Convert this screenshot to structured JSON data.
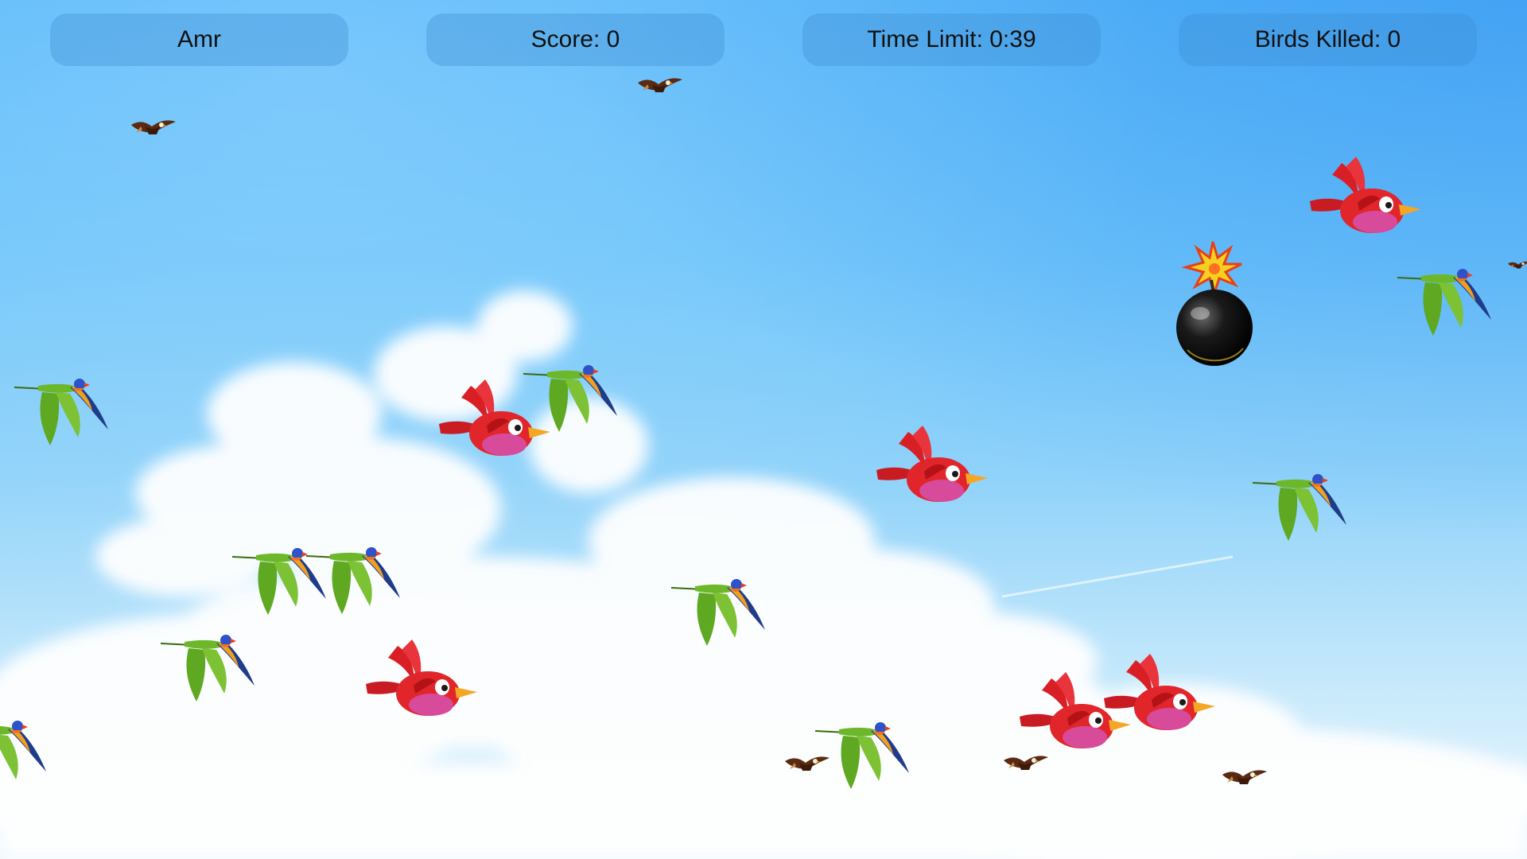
{
  "hud": {
    "player_name": "Amr",
    "score": "Score: 0",
    "time_limit": "Time Limit: 0:39",
    "birds_killed": "Birds Killed: 0"
  },
  "colors": {
    "sky_top": "#58b9fb",
    "sky_bottom": "#eef8fd",
    "hud_panel": "rgba(60,140,210,0.35)",
    "red_bird": "#e0262b",
    "parrot_green": "#6cb82a",
    "bomb": "#111111"
  },
  "sprites": {
    "red_bird": "red-cartoon-bird-icon",
    "parrot": "rainbow-lorikeet-icon",
    "eagle": "brown-eagle-icon",
    "bomb": "lit-bomb-icon"
  }
}
